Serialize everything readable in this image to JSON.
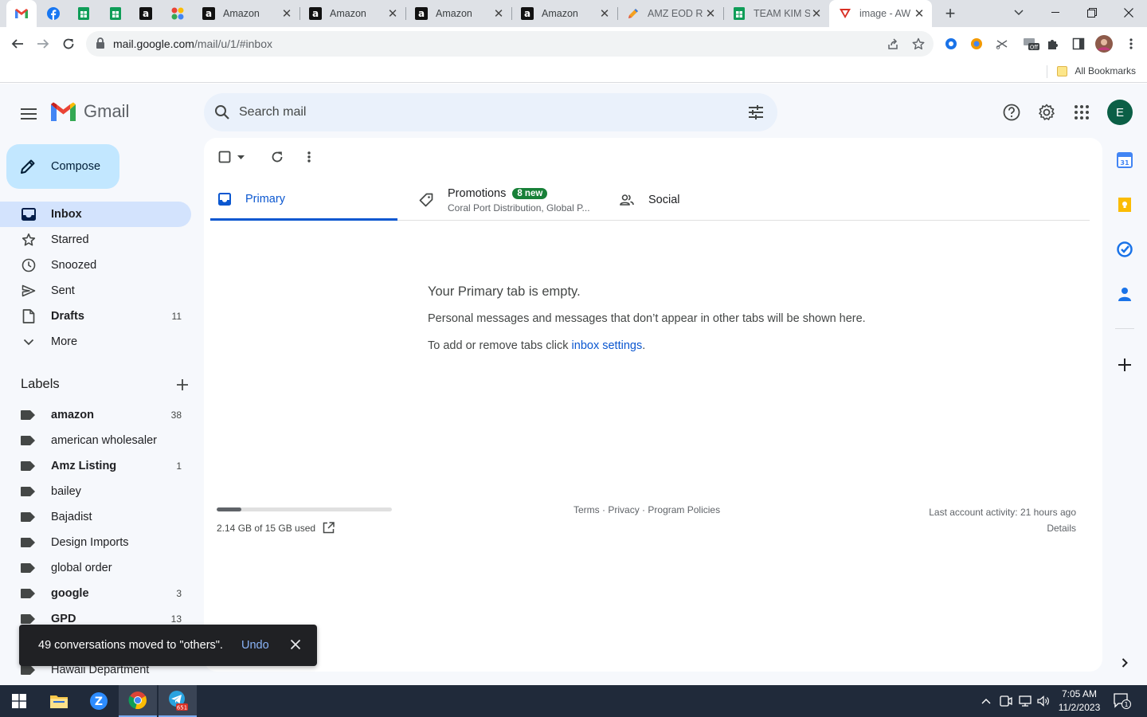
{
  "browser": {
    "tabs": [
      {
        "title": "Amazon",
        "icon": "amazon-icon"
      },
      {
        "title": "Amazon",
        "icon": "amazon-icon"
      },
      {
        "title": "Amazon",
        "icon": "amazon-icon"
      },
      {
        "title": "Amazon",
        "icon": "amazon-icon"
      },
      {
        "title": "AMZ EOD R",
        "icon": "pencil-icon"
      },
      {
        "title": "TEAM KIM S",
        "icon": "sheets-icon"
      },
      {
        "title": "image - AW",
        "icon": "alert-icon"
      }
    ],
    "url_host": "mail.google.com",
    "url_path": "/mail/u/1/#inbox",
    "bookmarks_label": "All Bookmarks"
  },
  "gmail": {
    "product_name": "Gmail",
    "search_placeholder": "Search mail",
    "compose_label": "Compose",
    "avatar_letter": "E",
    "nav": [
      {
        "label": "Inbox",
        "count": "",
        "icon": "inbox-icon"
      },
      {
        "label": "Starred",
        "count": "",
        "icon": "star-icon"
      },
      {
        "label": "Snoozed",
        "count": "",
        "icon": "clock-icon"
      },
      {
        "label": "Sent",
        "count": "",
        "icon": "send-icon"
      },
      {
        "label": "Drafts",
        "count": "11",
        "icon": "draft-icon"
      },
      {
        "label": "More",
        "count": "",
        "icon": "chevron-down-icon"
      }
    ],
    "labels_heading": "Labels",
    "labels": [
      {
        "name": "amazon",
        "count": "38"
      },
      {
        "name": "american wholesaler",
        "count": ""
      },
      {
        "name": "Amz Listing",
        "count": "1"
      },
      {
        "name": "bailey",
        "count": ""
      },
      {
        "name": "Bajadist",
        "count": ""
      },
      {
        "name": "Design Imports",
        "count": ""
      },
      {
        "name": "global order",
        "count": ""
      },
      {
        "name": "google",
        "count": "3"
      },
      {
        "name": "GPD",
        "count": "13"
      },
      {
        "name": "",
        "count": ""
      },
      {
        "name": "Hawaii Department",
        "count": ""
      }
    ],
    "tabs": {
      "primary": "Primary",
      "promotions": "Promotions",
      "promotions_badge": "8 new",
      "promotions_sub": "Coral Port Distribution, Global P...",
      "social": "Social"
    },
    "empty": {
      "heading": "Your Primary tab is empty.",
      "line1": "Personal messages and messages that don’t appear in other tabs will be shown here.",
      "line2_prefix": "To add or remove tabs click ",
      "line2_link": "inbox settings",
      "line2_suffix": "."
    },
    "storage": {
      "used_text": "2.14 GB of 15 GB used",
      "fraction": 0.143
    },
    "footer": {
      "terms": "Terms",
      "privacy": "Privacy",
      "policies": "Program Policies",
      "sep": "·",
      "last_activity": "Last account activity: 21 hours ago",
      "details": "Details"
    },
    "snackbar": {
      "message": "49 conversations moved to \"others\".",
      "action": "Undo"
    }
  },
  "taskbar": {
    "time": "7:05 AM",
    "date": "11/2/2023",
    "telegram_badge": "651",
    "notification_count": "1"
  },
  "colors": {
    "accent": "#0b57d0",
    "compose_bg": "#c2e7ff",
    "active_nav_bg": "#d3e3fd",
    "badge_green": "#188038",
    "avatar_bg": "#0b5f46"
  }
}
